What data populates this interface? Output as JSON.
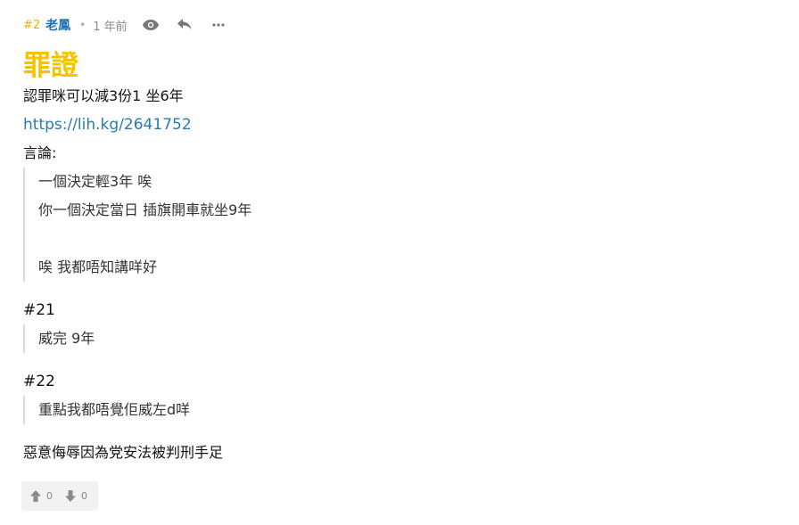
{
  "post": {
    "number": "#2",
    "author": "老鳳",
    "separator": "•",
    "time": "1 年前",
    "title": "罪證",
    "line1": "認罪咪可以減3份1 坐6年",
    "link": "https://lih.kg/2641752",
    "comment_label": "言論:",
    "quote1": [
      "一個決定輕3年 唉",
      "你一個決定當日 插旗開車就坐9年",
      "",
      "唉 我都唔知講咩好"
    ],
    "ref1": "#21",
    "quote2": "威完 9年",
    "ref2": "#22",
    "quote3": "重點我都唔覺佢威左d咩",
    "closing": "惡意侮辱因為党安法被判刑手足"
  },
  "votes": {
    "up_count": "0",
    "down_count": "0"
  },
  "icons": {
    "view": "eye-icon",
    "reply": "reply-icon",
    "more": "more-icon",
    "up": "arrow-up-icon",
    "down": "arrow-down-icon"
  },
  "colors": {
    "accent": "#f5c400",
    "author": "#1d72b8",
    "link": "#2a7ab0"
  }
}
